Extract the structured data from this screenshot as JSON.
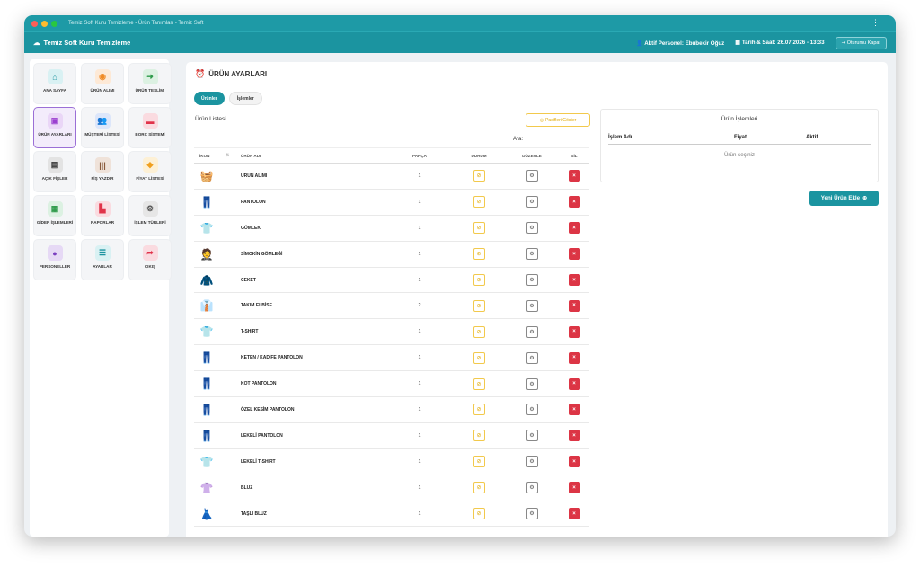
{
  "window": {
    "title": "Temiz Soft Kuru Temizleme - Ürün Tanımları - Temiz Soft",
    "theme_color": "#1b94a0"
  },
  "appbar": {
    "brand": "Temiz Soft Kuru Temizleme",
    "personnel_label": "Aktif Personel: Ebubekir Oğuz",
    "datetime_label": "Tarih & Saat: 26.07.2026 - 13:33",
    "logout_label": "Oturumu Kapat"
  },
  "sidebar": {
    "items": [
      {
        "label": "ANA SAYFA",
        "icon": "home-icon",
        "glyph": "⌂",
        "color": "#1b94a0",
        "bg": "#d9f1f3"
      },
      {
        "label": "ÜRÜN ALIMI",
        "icon": "target-icon",
        "glyph": "◉",
        "color": "#f08a24",
        "bg": "#fde9d6"
      },
      {
        "label": "ÜRÜN TESLİMİ",
        "icon": "delivery-icon",
        "glyph": "➜",
        "color": "#2e9a4a",
        "bg": "#dcf1e2"
      },
      {
        "label": "ÜRÜN AYARLARI",
        "icon": "product-settings-icon",
        "glyph": "▣",
        "color": "#9b3fd0",
        "bg": "#ead6f7"
      },
      {
        "label": "MÜŞTERİ LİSTESİ",
        "icon": "users-icon",
        "glyph": "👥",
        "color": "#3a6fd8",
        "bg": "#dce6fa"
      },
      {
        "label": "BORÇ SİSTEMİ",
        "icon": "wallet-icon",
        "glyph": "▬",
        "color": "#e0334a",
        "bg": "#fadbe0"
      },
      {
        "label": "AÇIK FİŞLER",
        "icon": "receipt-icon",
        "glyph": "▤",
        "color": "#333333",
        "bg": "#e3e3e3"
      },
      {
        "label": "FİŞ YAZDIR",
        "icon": "barcode-icon",
        "glyph": "|||",
        "color": "#8a5a3b",
        "bg": "#efe2d9"
      },
      {
        "label": "FİYAT LİSTESİ",
        "icon": "tag-icon",
        "glyph": "◆",
        "color": "#f0a020",
        "bg": "#fdf0d5"
      },
      {
        "label": "GİDER İŞLEMLERİ",
        "icon": "cash-icon",
        "glyph": "▦",
        "color": "#2e9a4a",
        "bg": "#dcf1e2"
      },
      {
        "label": "RAPORLAR",
        "icon": "chart-icon",
        "glyph": "▙",
        "color": "#e0334a",
        "bg": "#fadbe0"
      },
      {
        "label": "İŞLEM TÜRLERİ",
        "icon": "gears-icon",
        "glyph": "⚙",
        "color": "#555555",
        "bg": "#e6e6e6"
      },
      {
        "label": "PERSONELLER",
        "icon": "person-icon",
        "glyph": "●",
        "color": "#7b3fc0",
        "bg": "#e6d9f5"
      },
      {
        "label": "AYARLAR",
        "icon": "sliders-icon",
        "glyph": "☰",
        "color": "#1b94a0",
        "bg": "#d9f1f3"
      },
      {
        "label": "ÇIKIŞ",
        "icon": "exit-icon",
        "glyph": "➦",
        "color": "#e0334a",
        "bg": "#fadbe0"
      }
    ]
  },
  "page": {
    "title": "ÜRÜN AYARLARI",
    "tabs": [
      "Ürünler",
      "İşlemler"
    ],
    "list_title": "Ürün Listesi",
    "passive_button": "Pasifleri Göster",
    "search_label": "Ara:"
  },
  "table": {
    "headers": {
      "icon": "İKON",
      "name": "ÜRÜN ADI",
      "parts": "PARÇA",
      "status": "DURUM",
      "edit": "DÜZENLE",
      "delete": "SİL"
    },
    "rows": [
      {
        "name": "ÜRÜN ALIMI",
        "parts": "1",
        "icon": "basket-icon",
        "glyph": "🧺"
      },
      {
        "name": "PANTOLON",
        "parts": "1",
        "icon": "trousers-icon",
        "glyph": "👖"
      },
      {
        "name": "GÖMLEK",
        "parts": "1",
        "icon": "shirt-icon",
        "glyph": "👕"
      },
      {
        "name": "SİMOKİN GÖMLEĞİ",
        "parts": "1",
        "icon": "tuxedo-icon",
        "glyph": "🤵"
      },
      {
        "name": "CEKET",
        "parts": "1",
        "icon": "jacket-icon",
        "glyph": "🧥"
      },
      {
        "name": "TAKIM ELBİSE",
        "parts": "2",
        "icon": "suit-icon",
        "glyph": "👔"
      },
      {
        "name": "T-SHIRT",
        "parts": "1",
        "icon": "tshirt-icon",
        "glyph": "👕"
      },
      {
        "name": "KETEN / KADİFE PANTOLON",
        "parts": "1",
        "icon": "linen-trousers-icon",
        "glyph": "👖"
      },
      {
        "name": "KOT PANTOLON",
        "parts": "1",
        "icon": "jeans-icon",
        "glyph": "👖"
      },
      {
        "name": "ÖZEL KESİM PANTOLON",
        "parts": "1",
        "icon": "custom-trousers-icon",
        "glyph": "👖"
      },
      {
        "name": "LEKELİ PANTOLON",
        "parts": "1",
        "icon": "stained-trousers-icon",
        "glyph": "👖"
      },
      {
        "name": "LEKELİ T-SHIRT",
        "parts": "1",
        "icon": "stained-tshirt-icon",
        "glyph": "👕"
      },
      {
        "name": "BLUZ",
        "parts": "1",
        "icon": "blouse-icon",
        "glyph": "👚"
      },
      {
        "name": "TAŞLI BLUZ",
        "parts": "1",
        "icon": "beaded-blouse-icon",
        "glyph": "👗"
      }
    ]
  },
  "ops": {
    "title": "Ürün İşlemleri",
    "headers": [
      "İşlem Adı",
      "Fiyat",
      "Aktif"
    ],
    "empty_text": "Ürün seçiniz",
    "new_button": "Yeni Ürün Ekle"
  }
}
